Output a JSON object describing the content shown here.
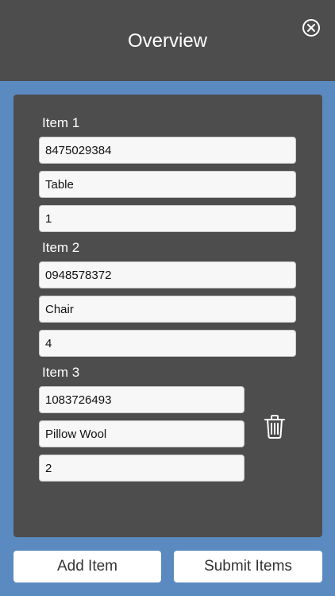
{
  "header": {
    "title": "Overview",
    "close_icon": "close-circle-icon"
  },
  "items": [
    {
      "label": "Item 1",
      "code": "8475029384",
      "name": "Table",
      "quantity": "1"
    },
    {
      "label": "Item 2",
      "code": "0948578372",
      "name": "Chair",
      "quantity": "4"
    },
    {
      "label": "Item 3",
      "code": "1083726493",
      "name": "Pillow Wool",
      "quantity": "2",
      "delete_icon": "trash-icon"
    }
  ],
  "footer": {
    "add_label": "Add Item",
    "submit_label": "Submit Items"
  },
  "colors": {
    "header_bg": "#4d4d4d",
    "page_bg": "#5b8ac1",
    "panel_bg": "#4d4d4d",
    "field_bg": "#f7f7f7"
  }
}
